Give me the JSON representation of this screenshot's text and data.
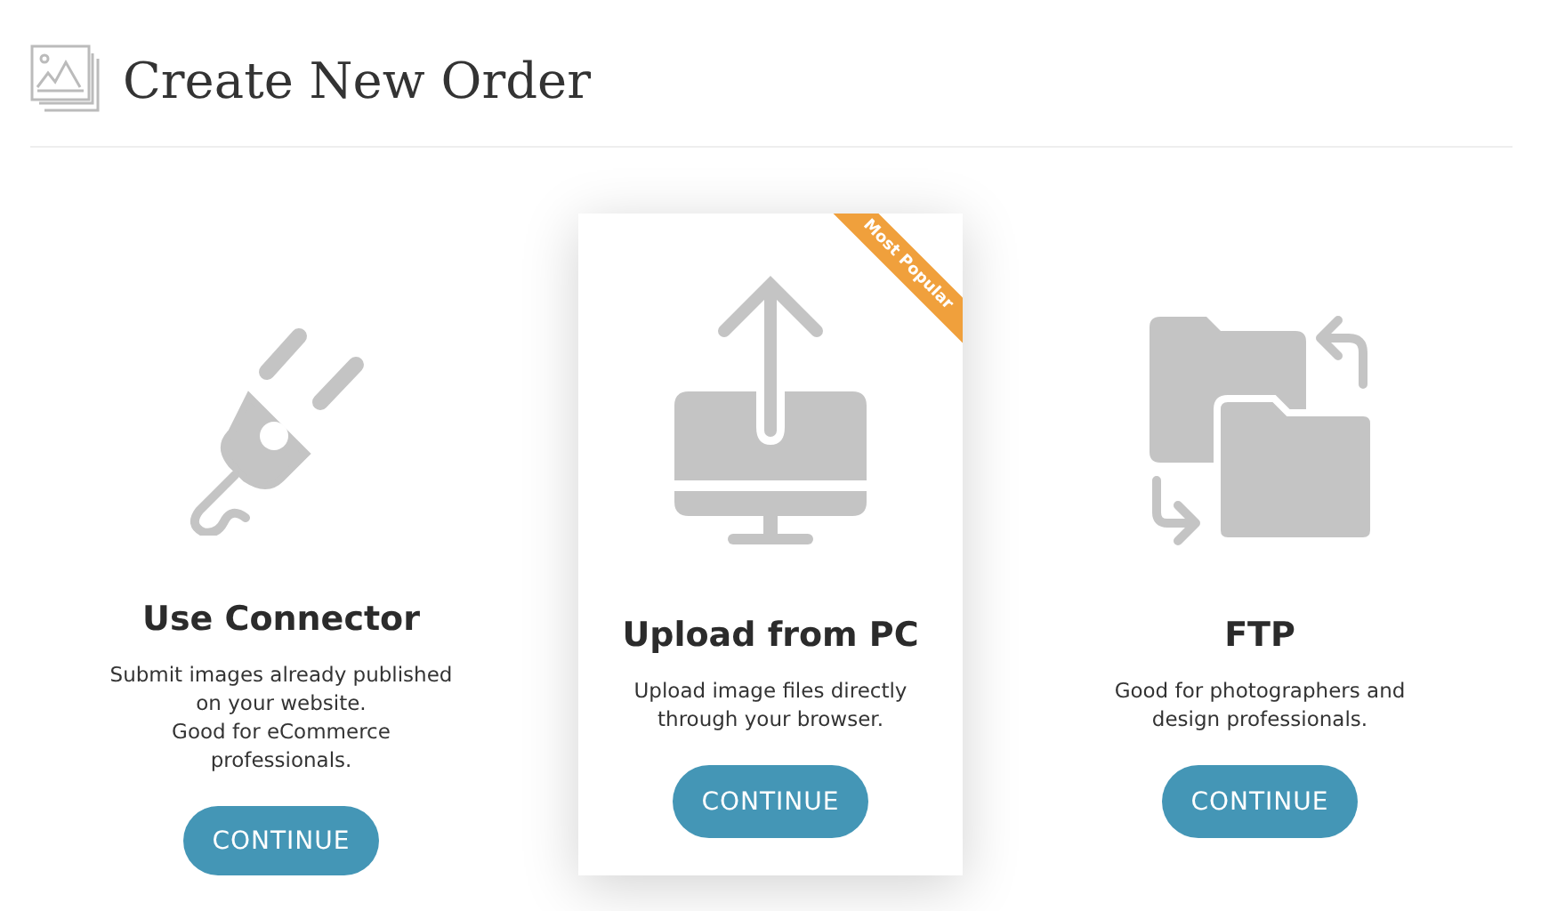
{
  "header": {
    "title": "Create New Order"
  },
  "options": [
    {
      "kind": "connector",
      "title": "Use Connector",
      "description": [
        "Submit images already published on your website.",
        "Good for eCommerce professionals."
      ],
      "button": "CONTINUE",
      "selected": false
    },
    {
      "kind": "upload",
      "title": "Upload from PC",
      "description": [
        "Upload image files directly through your browser."
      ],
      "button": "CONTINUE",
      "selected": true,
      "badge": "Most Popular"
    },
    {
      "kind": "ftp",
      "title": "FTP",
      "description": [
        "Good for photographers and design professionals."
      ],
      "button": "CONTINUE",
      "selected": false
    }
  ]
}
